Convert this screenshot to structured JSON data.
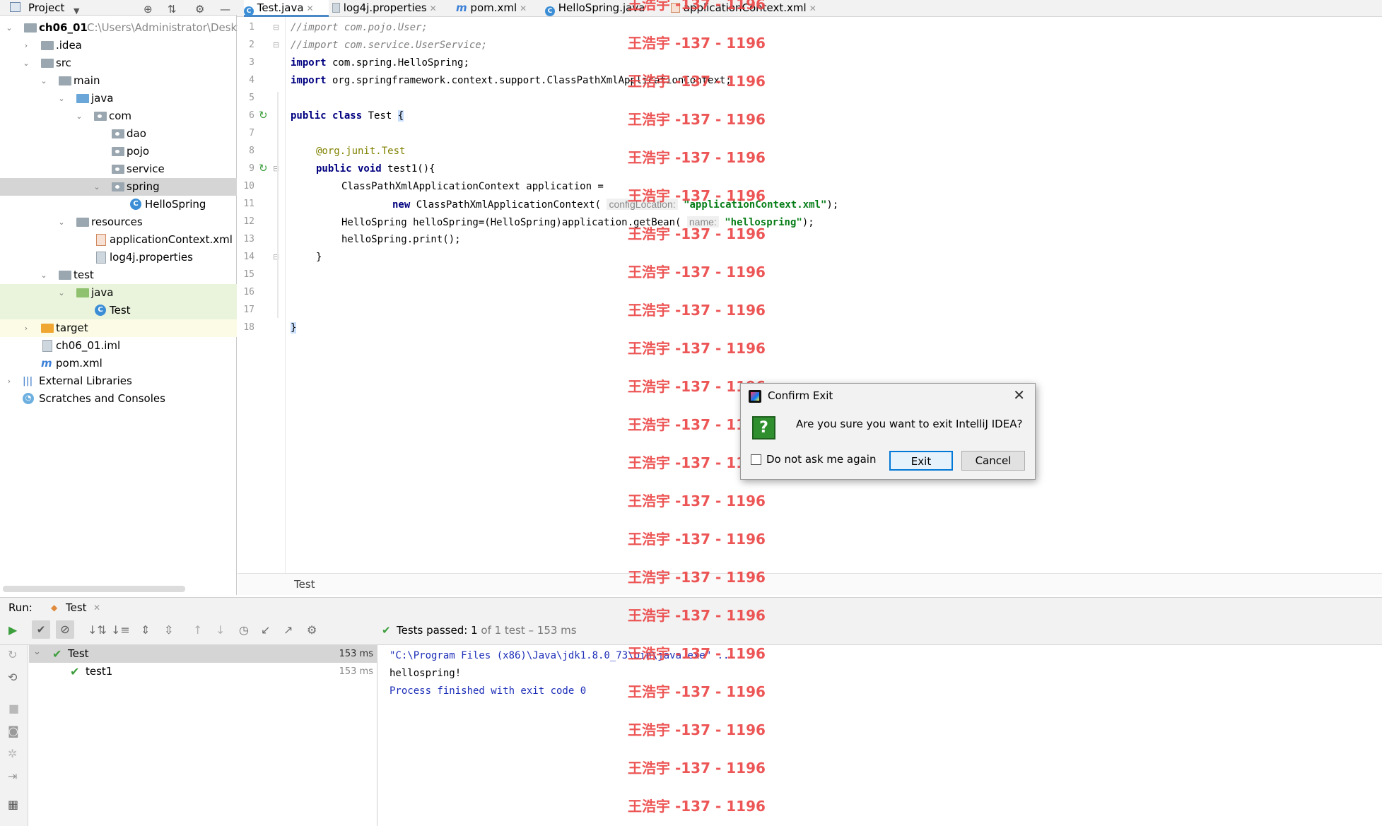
{
  "project_panel": {
    "title": "Project",
    "tree": [
      {
        "label": "ch06_01",
        "path": "C:\\Users\\Administrator\\Deskt"
      },
      {
        "label": ".idea"
      },
      {
        "label": "src"
      },
      {
        "label": "main"
      },
      {
        "label": "java"
      },
      {
        "label": "com"
      },
      {
        "label": "dao"
      },
      {
        "label": "pojo"
      },
      {
        "label": "service"
      },
      {
        "label": "spring"
      },
      {
        "label": "HelloSpring"
      },
      {
        "label": "resources"
      },
      {
        "label": "applicationContext.xml"
      },
      {
        "label": "log4j.properties"
      },
      {
        "label": "test"
      },
      {
        "label": "java"
      },
      {
        "label": "Test"
      },
      {
        "label": "target"
      },
      {
        "label": "ch06_01.iml"
      },
      {
        "label": "pom.xml"
      },
      {
        "label": "External Libraries"
      },
      {
        "label": "Scratches and Consoles"
      }
    ]
  },
  "tabs": [
    {
      "label": "Test.java",
      "icon": "class-icon"
    },
    {
      "label": "log4j.properties",
      "icon": "properties-icon"
    },
    {
      "label": "pom.xml",
      "icon": "maven-icon"
    },
    {
      "label": "HelloSpring.java",
      "icon": "class-icon"
    },
    {
      "label": "applicationContext.xml",
      "icon": "xml-icon"
    }
  ],
  "editor": {
    "line_numbers": [
      "1",
      "2",
      "3",
      "4",
      "5",
      "6",
      "7",
      "8",
      "9",
      "10",
      "11",
      "12",
      "13",
      "14",
      "15",
      "16",
      "17",
      "18"
    ],
    "code": {
      "l1": "//import com.pojo.User;",
      "l2": "//import com.service.UserService;",
      "l3_kw": "import",
      "l3": " com.spring.HelloSpring;",
      "l4_kw": "import",
      "l4": " org.springframework.context.support.ClassPathXmlApplicationContext;",
      "l6_kw": "public class",
      "l6": " Test ",
      "l6_brace": "{",
      "l8_at": "@org.junit.",
      "l8_ann": "Test",
      "l9_kw": "public void",
      "l9": " test1(){",
      "l10": "ClassPathXmlApplicationContext application =",
      "l11_kw": "new",
      "l11": " ClassPathXmlApplicationContext(",
      "l11_hint": "configLocation:",
      "l11_str": "\"applicationContext.xml\"",
      "l11_end": ");",
      "l12": "HelloSpring helloSpring=(HelloSpring)application.getBean(",
      "l12_hint": "name:",
      "l12_str": "\"hellospring\"",
      "l12_end": ");",
      "l13": "helloSpring.print();",
      "l14": "}",
      "l17": "}"
    },
    "breadcrumb": "Test"
  },
  "run_panel": {
    "label": "Run:",
    "tab": "Test",
    "status_prefix": "Tests passed:",
    "status_count": "1",
    "status_rest": "of 1 test – 153 ms",
    "tree": [
      {
        "label": "Test",
        "time": "153 ms"
      },
      {
        "label": "test1",
        "time": "153 ms"
      }
    ],
    "console": [
      "\"C:\\Program Files (x86)\\Java\\jdk1.8.0_73\\bin\\java.exe\" ...",
      "hellospring!",
      "Process finished with exit code 0"
    ],
    "colors": {
      "pass": "#3c9e3c",
      "exit_text": "#1c2eb8"
    }
  },
  "dialog": {
    "title": "Confirm Exit",
    "message": "Are you sure you want to exit IntelliJ IDEA?",
    "checkbox_label": "Do not ask me again",
    "checkbox_checked": false,
    "exit_label": "Exit",
    "cancel_label": "Cancel"
  },
  "watermark": {
    "text": "王浩宇 -137 - 1196",
    "color": "#ec4848"
  }
}
